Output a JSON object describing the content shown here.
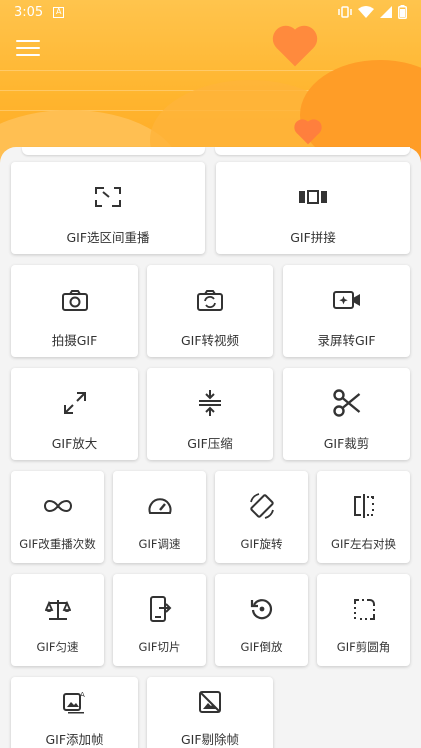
{
  "status": {
    "time": "3:05",
    "badge": "A"
  },
  "features": [
    {
      "label": "GIF选区间重播",
      "icon": "range-replay-icon"
    },
    {
      "label": "GIF拼接",
      "icon": "splice-icon"
    },
    {
      "label": "拍摄GIF",
      "icon": "camera-icon"
    },
    {
      "label": "GIF转视频",
      "icon": "convert-video-icon"
    },
    {
      "label": "录屏转GIF",
      "icon": "screen-record-icon"
    },
    {
      "label": "GIF放大",
      "icon": "expand-icon"
    },
    {
      "label": "GIF压缩",
      "icon": "compress-icon"
    },
    {
      "label": "GIF裁剪",
      "icon": "scissors-icon"
    },
    {
      "label": "GIF改重播次数",
      "icon": "infinity-icon"
    },
    {
      "label": "GIF调速",
      "icon": "speedometer-icon"
    },
    {
      "label": "GIF旋转",
      "icon": "rotate-icon"
    },
    {
      "label": "GIF左右对换",
      "icon": "flip-icon"
    },
    {
      "label": "GIF匀速",
      "icon": "balance-icon"
    },
    {
      "label": "GIF切片",
      "icon": "slice-icon"
    },
    {
      "label": "GIF倒放",
      "icon": "reverse-icon"
    },
    {
      "label": "GIF剪圆角",
      "icon": "round-corner-icon"
    },
    {
      "label": "GIF添加帧",
      "icon": "add-frame-icon"
    },
    {
      "label": "GIF剔除帧",
      "icon": "remove-frame-icon"
    }
  ]
}
